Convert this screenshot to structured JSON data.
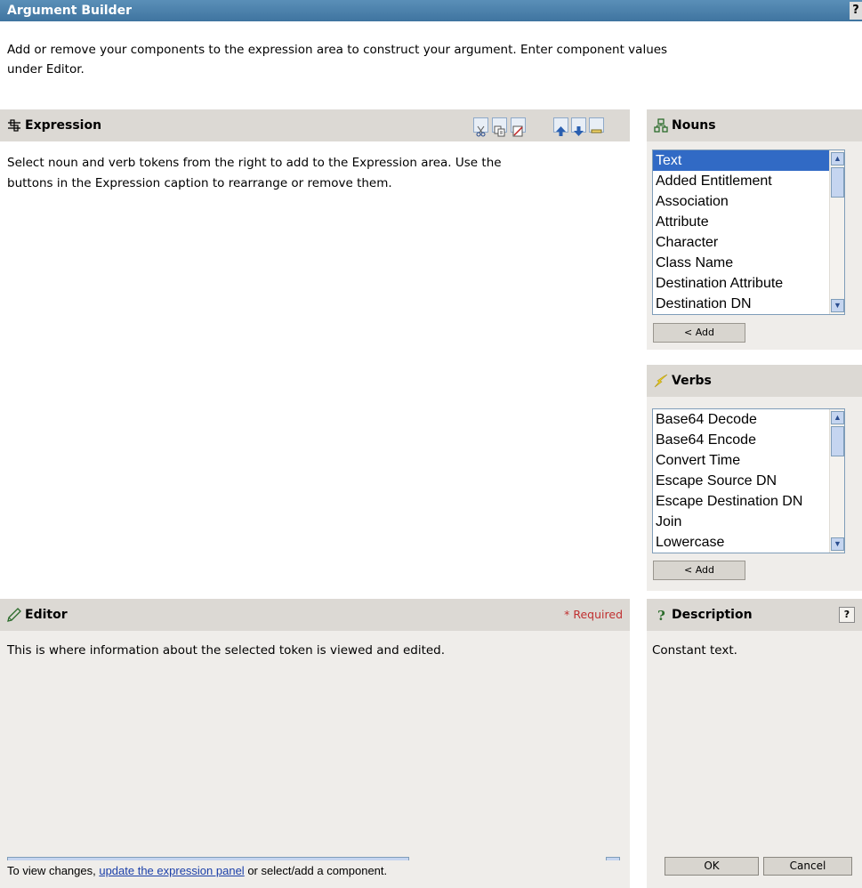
{
  "window": {
    "title": "Argument Builder",
    "help_glyph": "?"
  },
  "intro": {
    "text_line1": "Add or remove your components to the expression area to construct your argument. Enter component values",
    "text_line2": "under Editor."
  },
  "expression": {
    "title": "Expression",
    "help_line1": "Select noun and verb tokens from the right to add to the Expression area.  Use the",
    "help_line2": "buttons in the Expression caption to rearrange or remove them.",
    "tools": [
      "cut-icon",
      "copy-icon",
      "paste-icon",
      "move-up-icon",
      "move-down-icon",
      "remove-icon"
    ]
  },
  "nouns": {
    "title": "Nouns",
    "items": [
      "Text",
      "Added Entitlement",
      "Association",
      "Attribute",
      "Character",
      "Class Name",
      "Destination Attribute",
      "Destination DN"
    ],
    "selected": "Text",
    "add_label": "< Add"
  },
  "verbs": {
    "title": "Verbs",
    "items": [
      "Base64 Decode",
      "Base64 Encode",
      "Convert Time",
      "Escape Source DN",
      "Escape Destination DN",
      "Join",
      "Lowercase"
    ],
    "add_label": "< Add"
  },
  "editor": {
    "title": "Editor",
    "required_label": "* Required",
    "info": "This is where information about the selected token is viewed and edited.",
    "footer_prefix": "To view changes, ",
    "footer_link": "update the expression panel",
    "footer_suffix": " or select/add a component."
  },
  "description": {
    "title": "Description",
    "help_glyph": "?",
    "text": "Constant text."
  },
  "buttons": {
    "ok": "OK",
    "cancel": "Cancel"
  },
  "colors": {
    "title_bar": "#3f74a0",
    "panel_header": "#dcd9d4",
    "panel_body": "#efedea",
    "selection": "#316ac5",
    "required": "#c03030"
  }
}
